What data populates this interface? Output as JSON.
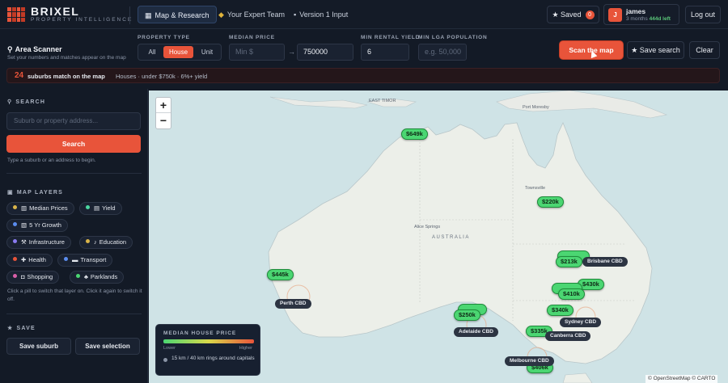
{
  "brand": {
    "name": "BRIXEL",
    "tagline": "PROPERTY INTELLIGENCE"
  },
  "nav": {
    "tabs": [
      {
        "label": "Map & Research",
        "icon": "map-icon",
        "active": true
      },
      {
        "label": "Your Expert Team",
        "icon": "handshake-icon",
        "active": false
      },
      {
        "label": "Version 1 Input",
        "icon": "chat-icon",
        "active": false
      }
    ],
    "saved_label": "Saved",
    "saved_count": "0",
    "user": {
      "initial": "J",
      "name": "james",
      "plan": "3 months",
      "time_left": "444d left"
    },
    "logout_label": "Log out"
  },
  "scanner": {
    "title": "Area Scanner",
    "subtitle": "Set your numbers and matches appear on the map",
    "property_type_label": "PROPERTY TYPE",
    "property_types": [
      "All",
      "House",
      "Unit"
    ],
    "selected_property_type": "House",
    "median_price_label": "MEDIAN PRICE",
    "min_price_placeholder": "Min $",
    "max_price_value": "750000",
    "min_yield_label": "MIN RENTAL YIELD",
    "min_yield_value": "6",
    "min_lga_label": "MIN LGA POPULATION",
    "min_lga_placeholder": "e.g. 50,000",
    "scan_button": "Scan the map",
    "save_search_button": "Save search",
    "clear_button": "Clear"
  },
  "match_banner": {
    "count": "24",
    "text": "suburbs match on the map",
    "criteria": "Houses · under $750k · 6%+ yield"
  },
  "sidebar": {
    "search_title": "SEARCH",
    "search_placeholder": "Suburb or property address...",
    "search_button": "Search",
    "search_hint": "Type a suburb or an address to begin.",
    "layers_title": "MAP LAYERS",
    "layers": [
      {
        "label": "Median Prices",
        "dot": "#d9b44a",
        "icon": "chart-icon"
      },
      {
        "label": "Yield",
        "dot": "#4bd6a0",
        "icon": "trend-icon"
      },
      {
        "label": "5 Yr Growth",
        "dot": "#5b8def",
        "icon": "growth-icon"
      },
      {
        "label": "Infrastructure",
        "dot": "#8a7bf0",
        "icon": "construction-icon"
      },
      {
        "label": "Education",
        "dot": "#d9b44a",
        "icon": "school-icon"
      },
      {
        "label": "Health",
        "dot": "#e8543a",
        "icon": "hospital-icon"
      },
      {
        "label": "Transport",
        "dot": "#5b8def",
        "icon": "bus-icon"
      },
      {
        "label": "Shopping",
        "dot": "#d95fa8",
        "icon": "shopping-icon"
      },
      {
        "label": "Parklands",
        "dot": "#4bd672",
        "icon": "tree-icon"
      }
    ],
    "layers_hint": "Click a pill to switch that layer on. Click it again to switch it off.",
    "save_title": "SAVE",
    "save_suburb_button": "Save suburb",
    "save_selection_button": "Save selection"
  },
  "map": {
    "zoom_in": "+",
    "zoom_out": "−",
    "place_labels": [
      "EAST TIMOR",
      "Port Moresby",
      "Townsville",
      "Alice Springs",
      "AUSTRALIA"
    ],
    "price_markers": [
      "$649k",
      "$220k",
      "$213k",
      "$410k",
      "$340k",
      "$335k",
      "$445k",
      "$250k",
      "$406k",
      "$430k",
      "$340k"
    ],
    "cbd_labels": [
      "Perth CBD",
      "Adelaide CBD",
      "Sydney CBD",
      "Canberra CBD",
      "Melbourne CBD",
      "Brisbane CBD"
    ],
    "legend": {
      "title": "MEDIAN HOUSE PRICE",
      "low": "Lower",
      "high": "Higher",
      "note": "15 km / 40 km rings around capitals"
    },
    "attribution": "© OpenStreetMap © CARTO"
  }
}
